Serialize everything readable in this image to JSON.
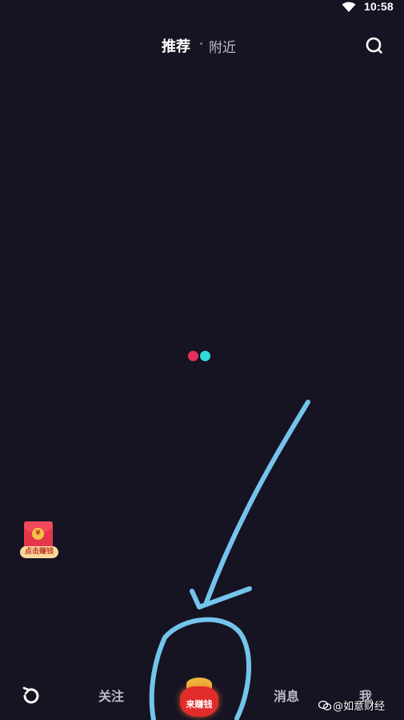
{
  "status_bar": {
    "time": "10:58",
    "wifi_icon": "wifi-icon"
  },
  "top_tabs": {
    "recommend": "推荐",
    "nearby": "附近",
    "search_icon": "search-icon"
  },
  "loading": {
    "colors": [
      "#e6305c",
      "#33d9d8"
    ]
  },
  "red_packet": {
    "coin_symbol": "¥",
    "label": "点击赚钱"
  },
  "bottom_nav": {
    "refresh_icon": "refresh-icon",
    "follow": "关注",
    "earn": "来赚钱",
    "messages": "消息",
    "me": "我"
  },
  "watermark": {
    "text": "@如意财经"
  },
  "colors": {
    "background": "#161422",
    "annotation": "#74c4ec",
    "accent_red": "#e6305c",
    "accent_cyan": "#33d9d8"
  }
}
